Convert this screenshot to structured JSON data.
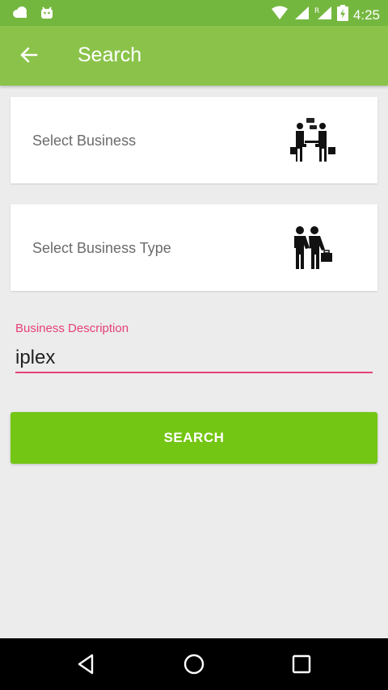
{
  "status_bar": {
    "time": "4:25",
    "icons": [
      "cloud-icon",
      "android-icon",
      "wifi-icon",
      "signal-icon",
      "signal-roaming-icon",
      "battery-icon"
    ]
  },
  "app_bar": {
    "title": "Search",
    "back_icon": "arrow-left-icon"
  },
  "business_card": {
    "label": "Select Business",
    "icon": "business-meeting-icon"
  },
  "business_type_card": {
    "label": "Select Business Type",
    "icon": "handshake-icon"
  },
  "description_field": {
    "label": "Business Description",
    "value": "iplex"
  },
  "search_button": {
    "label": "SEARCH"
  },
  "nav_bar": {
    "icons": [
      "back-triangle-icon",
      "home-circle-icon",
      "recents-square-icon"
    ]
  },
  "colors": {
    "app_bar": "#8bc34a",
    "status_bar": "#74b73f",
    "accent": "#e5407a",
    "button": "#74c614",
    "background": "#ececec"
  }
}
